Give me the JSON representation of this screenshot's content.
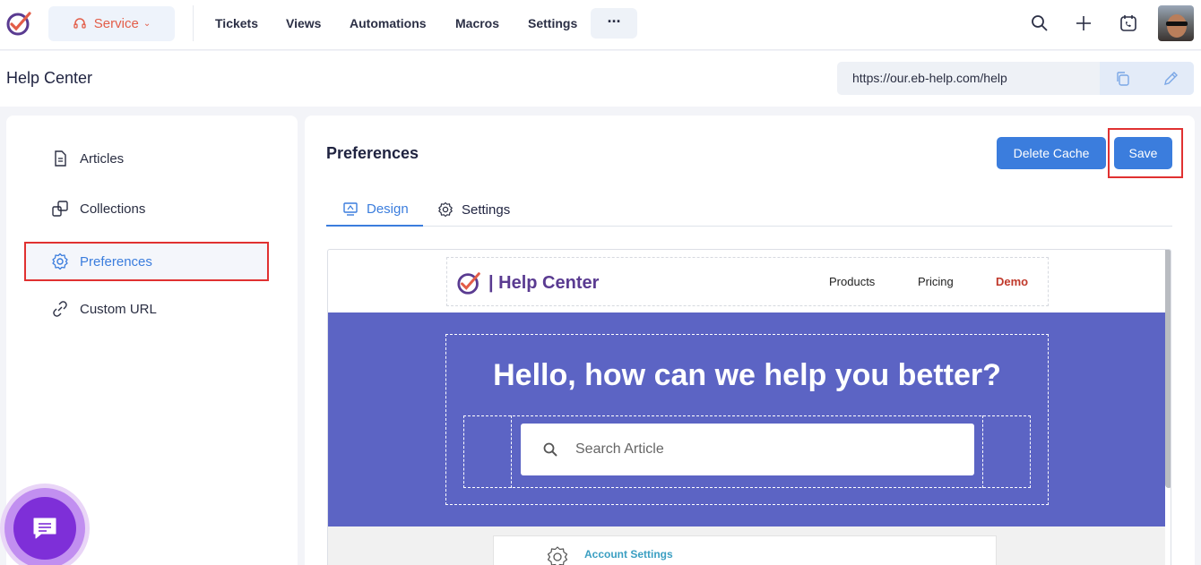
{
  "topbar": {
    "service_label": "Service",
    "nav": [
      "Tickets",
      "Views",
      "Automations",
      "Macros",
      "Settings"
    ],
    "more_label": "···"
  },
  "header": {
    "title": "Help Center",
    "url": "https://our.eb-help.com/help"
  },
  "sidebar": {
    "items": [
      {
        "label": "Articles",
        "icon": "document-icon"
      },
      {
        "label": "Collections",
        "icon": "collections-icon"
      },
      {
        "label": "Preferences",
        "icon": "gear-icon",
        "active": true
      },
      {
        "label": "Custom URL",
        "icon": "link-icon"
      }
    ]
  },
  "main": {
    "title": "Preferences",
    "delete_cache_label": "Delete Cache",
    "save_label": "Save",
    "tabs": [
      {
        "label": "Design",
        "icon": "monitor-icon",
        "active": true
      },
      {
        "label": "Settings",
        "icon": "gear-icon",
        "active": false
      }
    ]
  },
  "preview": {
    "brand": "| Help Center",
    "links": [
      "Products",
      "Pricing",
      "Demo"
    ],
    "hero_title": "Hello, how can we help you better?",
    "search_placeholder": "Search Article",
    "card_label": "Account Settings"
  },
  "colors": {
    "accent": "#3b7ddd",
    "hero": "#5c64c4",
    "highlight_border": "#e03131",
    "service": "#e35d48",
    "chat": "#7e2fd8"
  }
}
